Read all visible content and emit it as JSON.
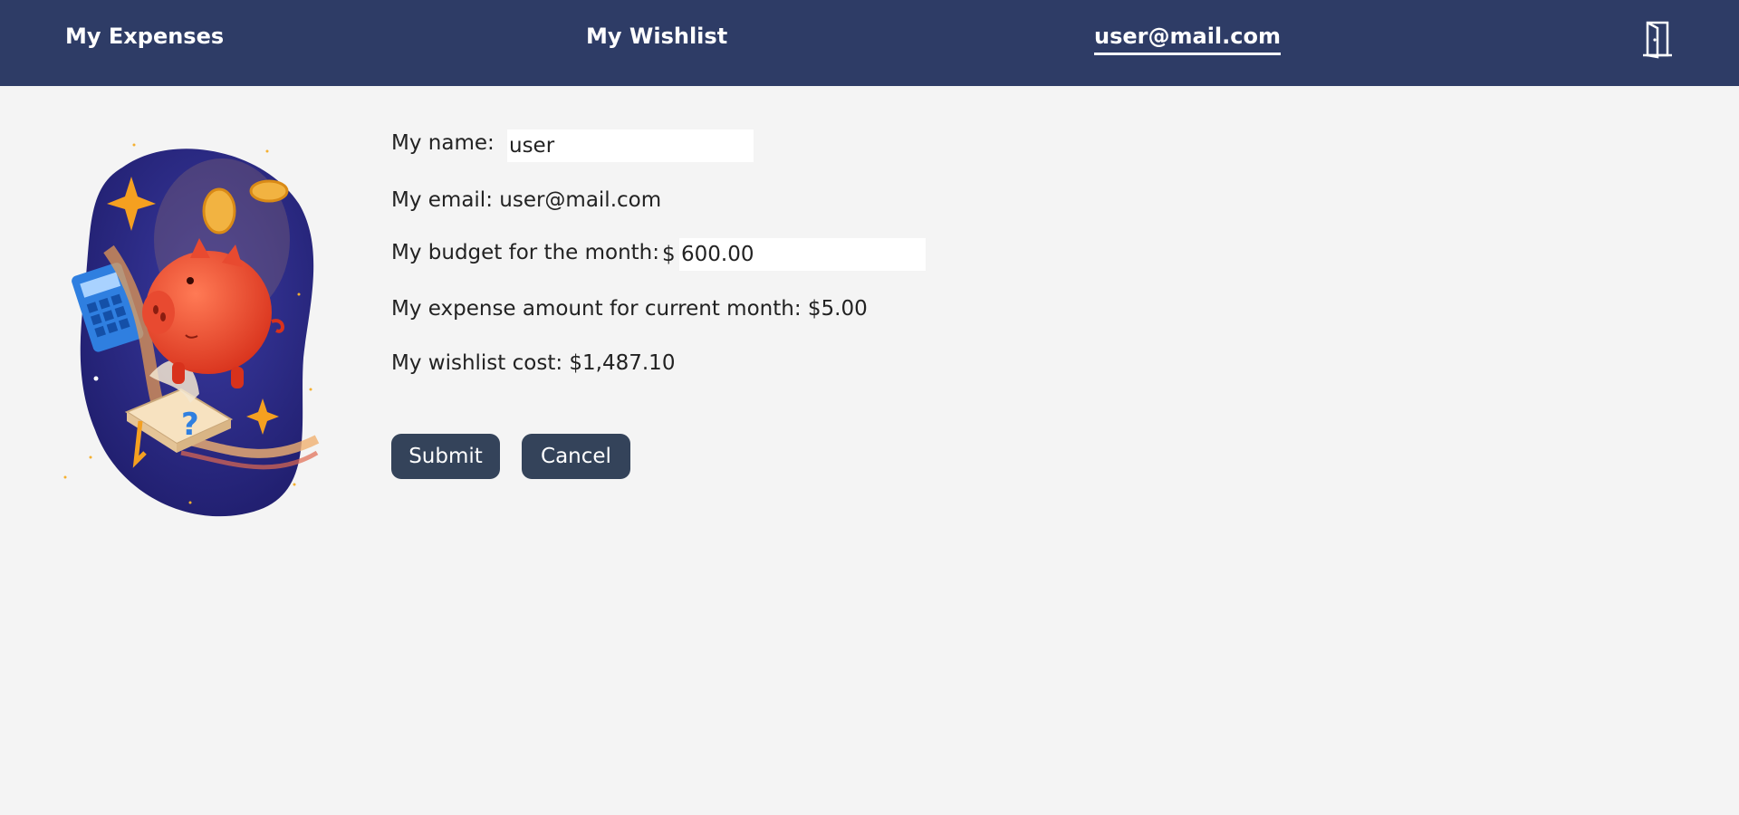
{
  "nav": {
    "expenses": "My Expenses",
    "wishlist": "My Wishlist",
    "user": "user@mail.com",
    "logout_icon": "door-icon"
  },
  "profile": {
    "name_label": "My name:",
    "name_value": "user",
    "email_text": "My email: user@mail.com",
    "budget_label": "My budget for the month:",
    "currency_symbol": "$",
    "budget_value": "600.00",
    "expense_text": "My expense amount for current month: $5.00",
    "wishlist_text": "My wishlist cost: $1,487.10"
  },
  "buttons": {
    "submit": "Submit",
    "cancel": "Cancel"
  },
  "illustration": {
    "icon": "piggy-bank-illustration"
  },
  "colors": {
    "navbar": "#2e3c66",
    "button": "#34435a",
    "background": "#f4f4f4"
  }
}
